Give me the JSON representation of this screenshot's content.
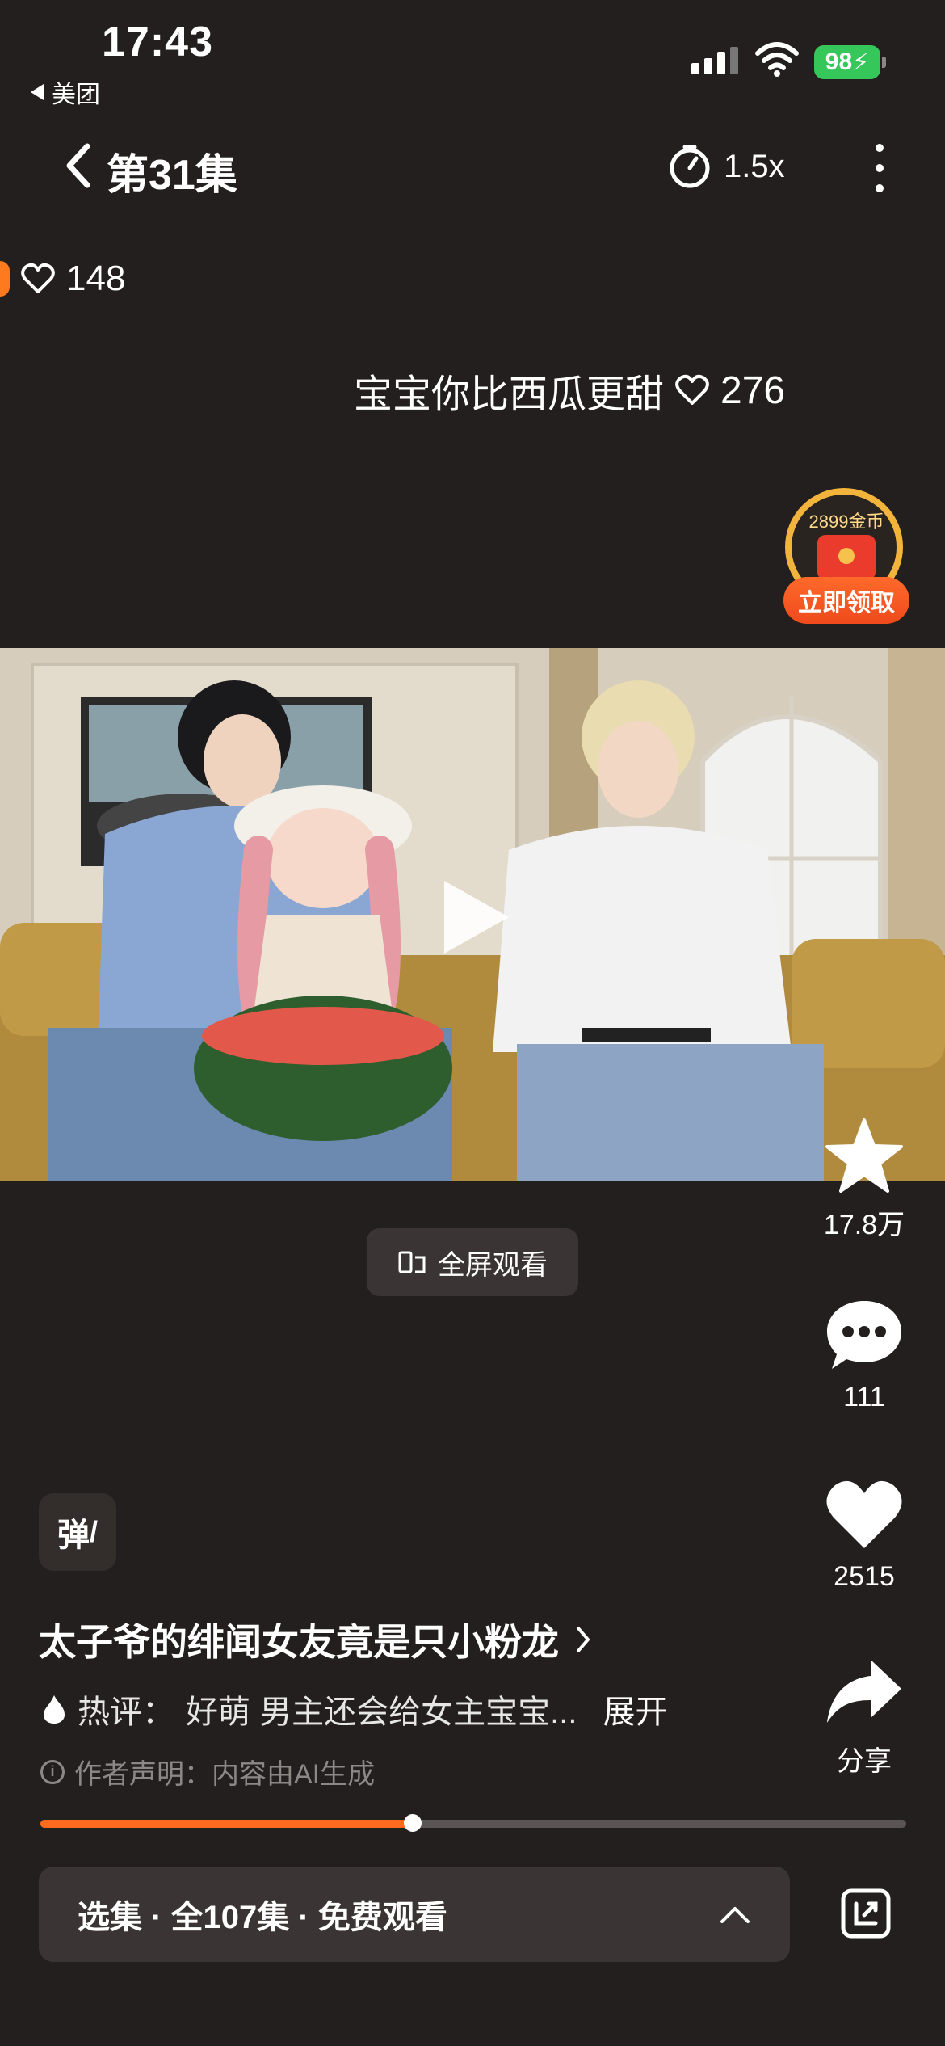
{
  "status_bar": {
    "time": "17:43",
    "back_app": "美团",
    "battery": "98"
  },
  "nav": {
    "title": "第31集",
    "speed": "1.5x"
  },
  "danmaku": [
    {
      "text": "",
      "likes": "148"
    },
    {
      "text": "宝宝你比西瓜更甜",
      "likes": "276"
    }
  ],
  "coin_badge": {
    "amount": "2899金币",
    "button": "立即领取"
  },
  "fullscreen_label": "全屏观看",
  "rail": {
    "favorite_count": "17.8万",
    "comment_count": "111",
    "like_count": "2515",
    "share_label": "分享"
  },
  "danmu_toggle": "弹",
  "drama": {
    "title": "太子爷的绯闻女友竟是只小粉龙",
    "hot_label": "热评：",
    "hot_comment": "好萌 男主还会给女主宝宝...",
    "expand": "展开",
    "declaration": "作者声明：内容由AI生成"
  },
  "progress": {
    "fraction": 0.43
  },
  "episode_bar": {
    "label": "选集 · 全107集 · 免费观看"
  },
  "colors": {
    "background": "#231f1e",
    "accent": "#ff6a1e",
    "battery": "#35c759"
  }
}
